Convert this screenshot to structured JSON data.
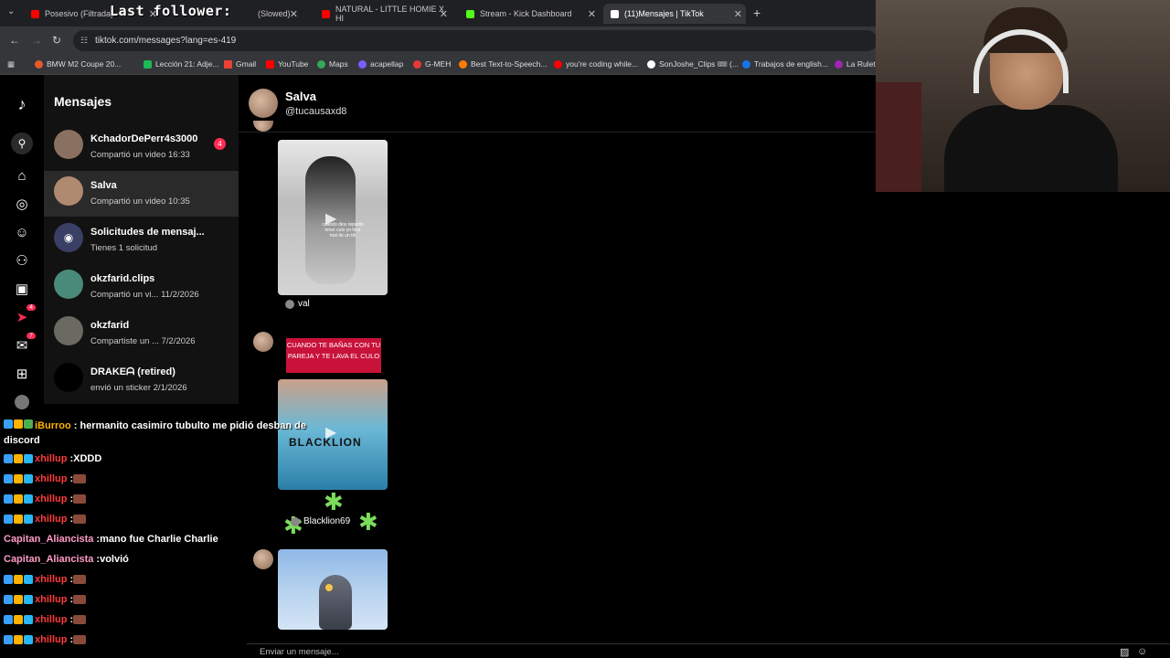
{
  "browser": {
    "tabs": [
      {
        "label": "Posesivo (Filtrada) - B",
        "color": "#ff0000"
      },
      {
        "label": "(Slowed)",
        "color": "#ff0000"
      },
      {
        "label": "NATURAL - LITTLE HOMIE X HI",
        "color": "#ff0000"
      },
      {
        "label": "Stream - Kick Dashboard",
        "color": "#53fc18"
      },
      {
        "label": "(11)Mensajes | TikTok",
        "color": "#ffffff"
      }
    ],
    "overlay_text": "Last follower:",
    "url": "tiktok.com/messages?lang=es-419",
    "bookmarks": [
      {
        "label": "BMW M2 Coupe 20...",
        "color": "#e65a2a"
      },
      {
        "label": "Lección 21: Adje...",
        "color": "#1db954"
      },
      {
        "label": "Gmail",
        "color": "#ea4335"
      },
      {
        "label": "YouTube",
        "color": "#ff0000"
      },
      {
        "label": "Maps",
        "color": "#34a853"
      },
      {
        "label": "acapellap",
        "color": "#7a5cff"
      },
      {
        "label": "G-MEH",
        "color": "#e53935"
      },
      {
        "label": "Best Text-to-Speech...",
        "color": "#ff7a00"
      },
      {
        "label": "you're coding while...",
        "color": "#ff0000"
      },
      {
        "label": "SonJoshe_Clips 🎟 (...",
        "color": "#ffffff"
      },
      {
        "label": "Trabajos de english...",
        "color": "#1a73e8"
      },
      {
        "label": "La Ruleta",
        "color": "#9c27b0"
      }
    ]
  },
  "tiktok": {
    "nav_badges": {
      "activity": "4",
      "messages": "7"
    },
    "inbox_title": "Mensajes",
    "conversations": [
      {
        "name": "KchadorDePerr4s3000",
        "sub": "Compartió un video 16:33",
        "count": "4",
        "avatar_color": "#8a7060"
      },
      {
        "name": "Salva",
        "sub": "Compartió un video 10:35",
        "count": "",
        "avatar_color": "#b08a70"
      },
      {
        "name": "Solicitudes de mensaj...",
        "sub": "Tienes 1 solicitud",
        "count": "",
        "avatar_color": "#3a3f66"
      },
      {
        "name": "okzfarid.clips",
        "sub": "Compartió un vi... 11/2/2026",
        "count": "",
        "avatar_color": "#4a8a7a"
      },
      {
        "name": "okzfarid",
        "sub": "Compartiste un ... 7/2/2026",
        "count": "",
        "avatar_color": "#6a6a60"
      },
      {
        "name": "DRAKEᗩ (retired)",
        "sub": "envió un sticker 2/1/2026",
        "count": "",
        "avatar_color": "#000000"
      }
    ],
    "chat": {
      "name": "Salva",
      "handle": "@tucausaxd8",
      "video1_caption": "cuando dios repartió tener culo yo hice mal de un tik",
      "video1_author": "val",
      "pink_caption": "CUANDO TE BAÑAS CON TU PAREJA Y TE LAVA EL CULO",
      "video2_logo": "BLACKLION",
      "video2_author": "Blacklion69",
      "input_placeholder": "Enviar un mensaje..."
    }
  },
  "stream_chat": [
    {
      "user": "iBurroo",
      "color": "#ffb300",
      "text": "hermanito casimiro tubulto me pidió desban de discord",
      "emote": false
    },
    {
      "user": "xhillup",
      "color": "#ff3b3b",
      "text": "XDDD",
      "emote": false
    },
    {
      "user": "xhillup",
      "color": "#ff3b3b",
      "text": "",
      "emote": true
    },
    {
      "user": "xhillup",
      "color": "#ff3b3b",
      "text": "",
      "emote": true
    },
    {
      "user": "xhillup",
      "color": "#ff3b3b",
      "text": "",
      "emote": true
    },
    {
      "user": "Capitan_Aliancista",
      "color": "#ff9cc6",
      "text": "mano fue Charlie Charlie",
      "emote": false
    },
    {
      "user": "Capitan_Aliancista",
      "color": "#ff9cc6",
      "text": "volvió",
      "emote": false
    },
    {
      "user": "xhillup",
      "color": "#ff3b3b",
      "text": "",
      "emote": true
    },
    {
      "user": "xhillup",
      "color": "#ff3b3b",
      "text": "",
      "emote": true
    },
    {
      "user": "xhillup",
      "color": "#ff3b3b",
      "text": "",
      "emote": true
    },
    {
      "user": "xhillup",
      "color": "#ff3b3b",
      "text": "",
      "emote": true
    }
  ]
}
